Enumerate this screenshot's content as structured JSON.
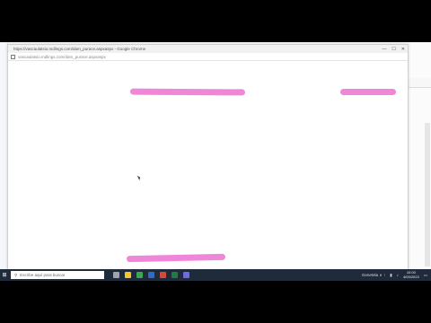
{
  "popup": {
    "title": "https://vascaulatsio.mdlings.com/dam_purace.aspxaspx - Google Chrome",
    "url": "vascaulatsio.mdlings.com/dam_purace.aspxaspx",
    "controls": {
      "minimize": "—",
      "maximize": "☐",
      "close": "✕"
    }
  },
  "taskbar": {
    "search_placeholder": "Escribe aquí para buscar",
    "tray_text": "GeneMia  ∧  ↑",
    "time": "10:00",
    "date": "4/09/2023",
    "colors": {
      "taskbar": "#1f2a3a"
    }
  },
  "scribble_color": "#ef86d8"
}
